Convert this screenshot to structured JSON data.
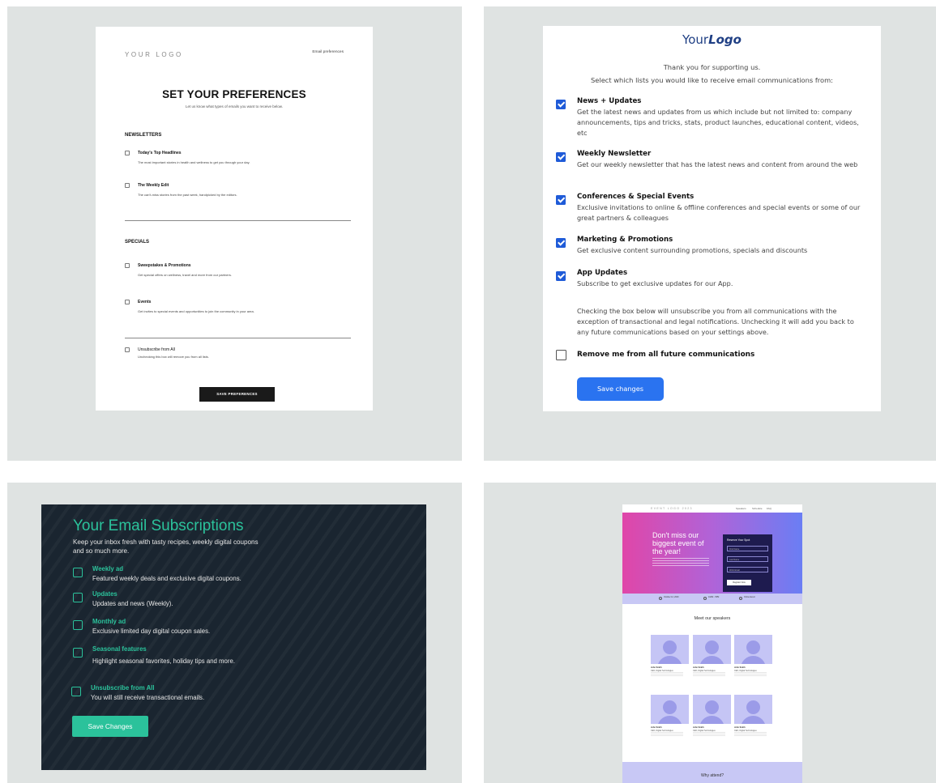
{
  "card1": {
    "logo": "YOUR LOGO",
    "email_preferences_link": "Email preferences",
    "title": "SET YOUR PREFERENCES",
    "subtitle": "Let us know what types of emails you want to receive below.",
    "sections": [
      {
        "heading": "NEWSLETTERS",
        "items": [
          {
            "label": "Today's Top Headlines",
            "desc": "The most important stories in health and wellness to get you through your day."
          },
          {
            "label": "The Weekly Edit",
            "desc": "The can't-miss stories from the past week, handpicked by the editors."
          }
        ]
      },
      {
        "heading": "SPECIALS",
        "items": [
          {
            "label": "Sweepstakes & Promotions",
            "desc": "Get special offers on wellness, travel and more from our partners."
          },
          {
            "label": "Events",
            "desc": "Get invites to special events and opportunities to join the community in your area."
          }
        ]
      }
    ],
    "unsubscribe": {
      "label": "Unsubscribe from All",
      "desc": "Unchecking this box will remove you from all lists."
    },
    "save_label": "SAVE PREFERENCES"
  },
  "card2": {
    "logo_regular": "Your",
    "logo_bold": "Logo",
    "intro_line1": "Thank you for supporting us.",
    "intro_line2": "Select which lists you would like to receive email communications from:",
    "lists": [
      {
        "title": "News + Updates",
        "desc": "Get the latest news and updates from us which include but not limited to: company announcements, tips and tricks, stats, product launches, educational content, videos, etc",
        "checked": true
      },
      {
        "title": "Weekly Newsletter",
        "desc": "Get our weekly newsletter that has the latest news and content from around the web",
        "checked": true
      },
      {
        "title": "Conferences & Special Events",
        "desc": "Exclusive invitations to online & offline conferences and special events or some of our great partners & colleagues",
        "checked": true
      },
      {
        "title": "Marketing & Promotions",
        "desc": "Get exclusive content surrounding promotions, specials and discounts",
        "checked": true
      },
      {
        "title": "App Updates",
        "desc": "Subscribe to get exclusive updates for our App.",
        "checked": true
      }
    ],
    "note": "Checking the box below will unsubscribe you from all communications with the exception of transactional and legal notifications. Unchecking it will add you back to any future communications based on your settings above.",
    "remove_label": "Remove me from all future communications",
    "save_label": "Save changes",
    "accent_color": "#2a73f0"
  },
  "card3": {
    "title": "Your Email Subscriptions",
    "subtitle": "Keep your inbox fresh with tasty recipes, weekly digital coupons and so much more.",
    "items": [
      {
        "title": "Weekly ad",
        "desc": "Featured weekly deals and exclusive digital coupons."
      },
      {
        "title": "Updates",
        "desc": "Updates and news (Weekly)."
      },
      {
        "title": "Monthly ad",
        "desc": "Exclusive limited day digital coupon sales."
      },
      {
        "title": "Seasonal features",
        "desc": "Highlight seasonal favorites, holiday tips and more."
      },
      {
        "title": "Unsubscribe from All",
        "desc": "You will still receive transactional emails."
      }
    ],
    "save_label": "Save Changes",
    "accent_color": "#2bc29b"
  },
  "card4": {
    "logo": "EVENT LOGO 2023",
    "nav": [
      "Speakers",
      "Schedule",
      "FAQ"
    ],
    "hero_text": "Don't miss our biggest event of the year!",
    "form_title": "Reserve Your Spot",
    "fields": [
      "First Name",
      "Last Name",
      "Work Email"
    ],
    "form_button": "Register Now",
    "strip": [
      "October 12, 2023",
      "10AM - 5PM",
      "Online Event"
    ],
    "speakers_heading": "Meet our speakers",
    "speakers": [
      {
        "name": "John Smith",
        "role": "CEO, Digital Technologies"
      },
      {
        "name": "John Smith",
        "role": "CEO, Digital Technologies"
      },
      {
        "name": "John Smith",
        "role": "CEO, Digital Technologies"
      },
      {
        "name": "John Smith",
        "role": "CEO, Digital Technologies"
      },
      {
        "name": "John Smith",
        "role": "CEO, Digital Technologies"
      },
      {
        "name": "John Smith",
        "role": "CEO, Digital Technologies"
      }
    ],
    "why_attend": "Why attend?"
  }
}
